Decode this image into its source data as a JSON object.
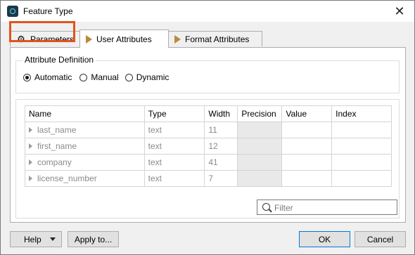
{
  "window": {
    "title": "Feature Type"
  },
  "tabs": [
    {
      "label": "Parameters",
      "icon": "gear-icon"
    },
    {
      "label": "User Attributes",
      "icon": "arrow-icon"
    },
    {
      "label": "Format Attributes",
      "icon": "arrow-icon"
    }
  ],
  "attribute_definition": {
    "label": "Attribute Definition",
    "options": [
      "Automatic",
      "Manual",
      "Dynamic"
    ],
    "selected": "Automatic"
  },
  "table": {
    "headers": [
      "Name",
      "Type",
      "Width",
      "Precision",
      "Value",
      "Index"
    ],
    "rows": [
      {
        "name": "last_name",
        "type": "text",
        "width": "11"
      },
      {
        "name": "first_name",
        "type": "text",
        "width": "12"
      },
      {
        "name": "company",
        "type": "text",
        "width": "41"
      },
      {
        "name": "license_number",
        "type": "text",
        "width": "7"
      }
    ]
  },
  "filter": {
    "placeholder": "Filter"
  },
  "buttons": {
    "help": "Help",
    "apply_to": "Apply to...",
    "ok": "OK",
    "cancel": "Cancel"
  },
  "colors": {
    "highlight": "#e2531e",
    "accent": "#0078d7"
  }
}
